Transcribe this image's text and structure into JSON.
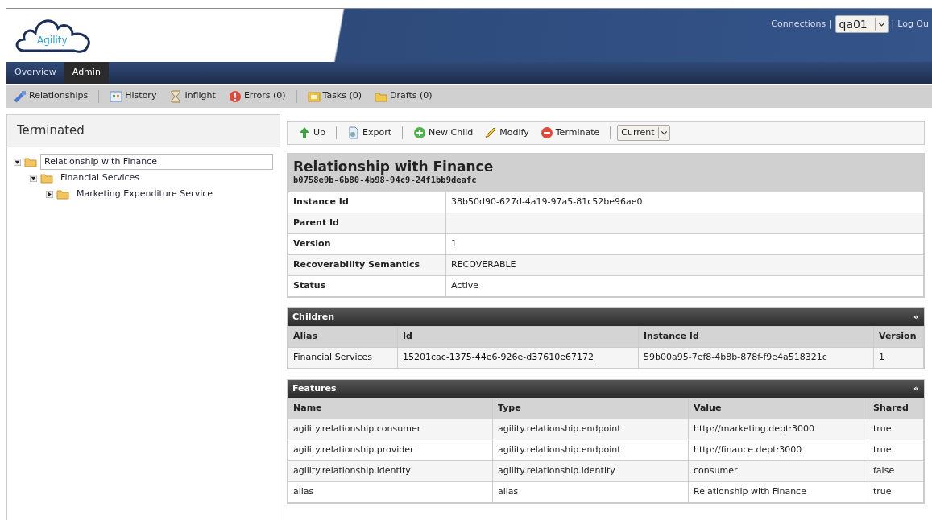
{
  "header": {
    "logo": "Agility",
    "connections_label": "Connections |",
    "connection": "qa01",
    "separator": "|",
    "logout": "Log Ou"
  },
  "nav_tabs": [
    {
      "label": "Overview",
      "selected": false
    },
    {
      "label": "Admin",
      "selected": true
    }
  ],
  "toolbar": [
    [
      "Relationships"
    ],
    [
      "History",
      "Inflight",
      "Errors (0)"
    ],
    [
      "Tasks (0)",
      "Drafts (0)"
    ]
  ],
  "left_panel": {
    "title": "Terminated",
    "tree": [
      {
        "label": "Relationship with Finance",
        "selected": true,
        "expanded": true,
        "children": [
          {
            "label": "Financial Services",
            "selected": false,
            "expanded": true,
            "children": [
              {
                "label": "Marketing Expenditure Service",
                "selected": false,
                "expanded": false
              }
            ]
          }
        ]
      }
    ]
  },
  "actions": [
    [
      "Up"
    ],
    [
      "Export"
    ],
    [
      "New Child",
      "Modify",
      "Terminate"
    ]
  ],
  "version_select": "Current",
  "detail": {
    "title": "Relationship with Finance",
    "subtitle": "b0758e9b-6b80-4b98-94c9-24f1bb9deafc",
    "properties": [
      {
        "label": "Instance Id",
        "value": "38b50d90-627d-4a19-97a5-81c52be96ae0"
      },
      {
        "label": "Parent Id"
      },
      {
        "label": "Version",
        "value": "1"
      },
      {
        "label": "Recoverability Semantics",
        "value": "RECOVERABLE"
      },
      {
        "label": "Status",
        "value": "Active"
      }
    ]
  },
  "children": {
    "title": "Children",
    "collapse": "«",
    "columns": [
      "Alias",
      "Id",
      "Instance Id",
      "Version"
    ],
    "rows": [
      [
        "Financial Services",
        "15201cac-1375-44e6-926e-d37610e67172",
        "59b00a95-7ef8-4b8b-878f-f9e4a518321c",
        "1"
      ]
    ]
  },
  "features": {
    "title": "Features",
    "collapse": "«",
    "columns": [
      "Name",
      "Type",
      "Value",
      "Shared"
    ],
    "rows": [
      [
        "agility.relationship.consumer",
        "agility.relationship.endpoint",
        "http://marketing.dept:3000",
        "true"
      ],
      [
        "agility.relationship.provider",
        "agility.relationship.endpoint",
        "http://finance.dept:3000",
        "true"
      ],
      [
        "agility.relationship.identity",
        "agility.relationship.identity",
        "consumer",
        "false"
      ],
      [
        "alias",
        "alias",
        "Relationship with Finance",
        "true"
      ]
    ]
  }
}
